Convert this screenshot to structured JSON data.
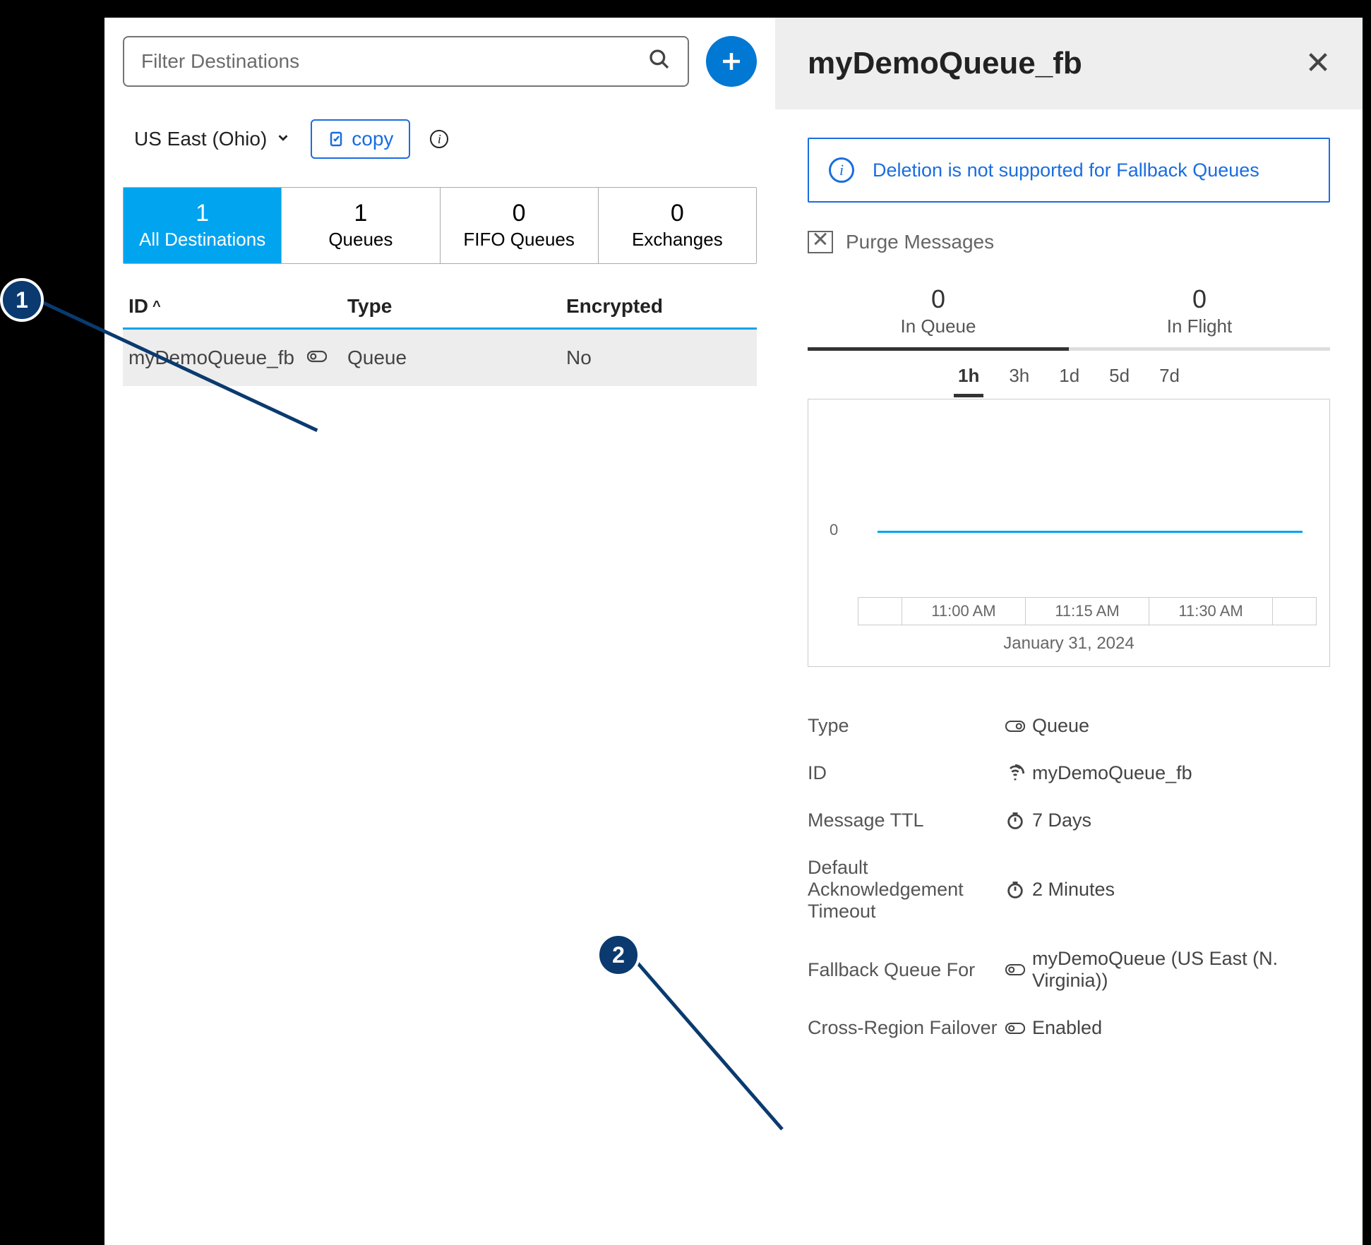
{
  "search": {
    "placeholder": "Filter Destinations"
  },
  "region": {
    "label": "US East (Ohio)"
  },
  "copy_label": "copy",
  "tabs": [
    {
      "count": "1",
      "label": "All Destinations",
      "active": true
    },
    {
      "count": "1",
      "label": "Queues",
      "active": false
    },
    {
      "count": "0",
      "label": "FIFO Queues",
      "active": false
    },
    {
      "count": "0",
      "label": "Exchanges",
      "active": false
    }
  ],
  "table": {
    "headers": {
      "id": "ID",
      "type": "Type",
      "encrypted": "Encrypted"
    },
    "rows": [
      {
        "id": "myDemoQueue_fb",
        "type": "Queue",
        "encrypted": "No"
      }
    ]
  },
  "detail": {
    "title": "myDemoQueue_fb",
    "info_banner": "Deletion is not supported for Fallback Queues",
    "purge_label": "Purge Messages",
    "stats": [
      {
        "num": "0",
        "lbl": "In Queue",
        "active": true
      },
      {
        "num": "0",
        "lbl": "In Flight",
        "active": false
      }
    ],
    "ranges": [
      "1h",
      "3h",
      "1d",
      "5d",
      "7d"
    ],
    "range_active": "1h",
    "chart_date": "January 31, 2024",
    "chart_xticks": [
      "11:00 AM",
      "11:15 AM",
      "11:30 AM"
    ],
    "chart_y0": "0",
    "props": [
      {
        "key": "Type",
        "val": "Queue",
        "icon": "queue"
      },
      {
        "key": "ID",
        "val": "myDemoQueue_fb",
        "icon": "fingerprint"
      },
      {
        "key": "Message TTL",
        "val": "7 Days",
        "icon": "clock"
      },
      {
        "key": "Default Acknowledgement Timeout",
        "val": "2 Minutes",
        "icon": "clock"
      },
      {
        "key": "Fallback Queue For",
        "val": "myDemoQueue (US East (N. Virginia))",
        "icon": "queue"
      },
      {
        "key": "Cross-Region Failover",
        "val": "Enabled",
        "icon": "queue"
      }
    ]
  },
  "callouts": {
    "c1": "1",
    "c2": "2"
  },
  "chart_data": {
    "type": "line",
    "title": "In Queue",
    "x_ticks": [
      "11:00 AM",
      "11:15 AM",
      "11:30 AM"
    ],
    "date": "January 31, 2024",
    "ylim": [
      0,
      1
    ],
    "series": [
      {
        "name": "In Queue",
        "values": [
          0,
          0,
          0,
          0
        ]
      }
    ]
  }
}
